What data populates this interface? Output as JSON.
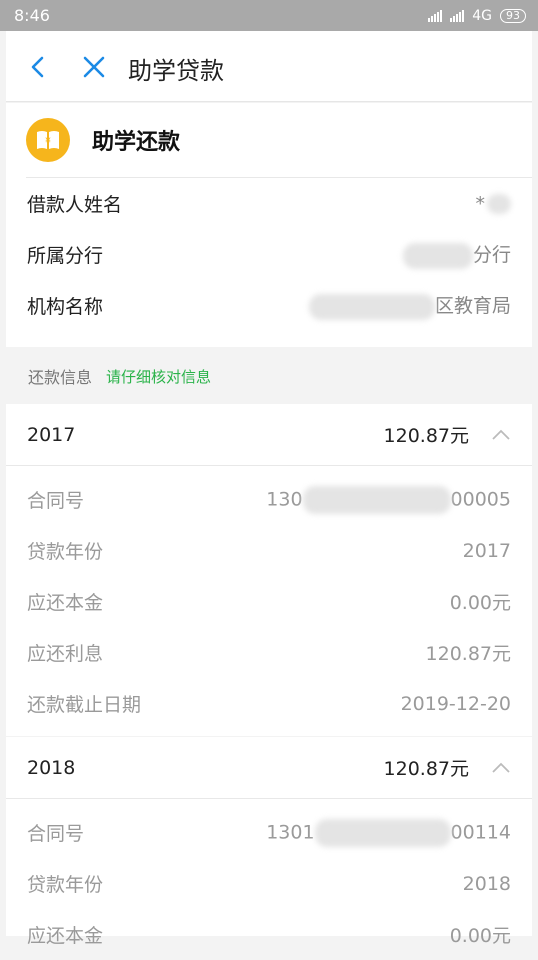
{
  "status": {
    "time": "8:46",
    "network": "4G",
    "battery": "93"
  },
  "header": {
    "title": "助学贷款"
  },
  "loan": {
    "title": "助学还款",
    "rows": [
      {
        "label": "借款人姓名",
        "value": "*"
      },
      {
        "label": "所属分行",
        "value": "分行"
      },
      {
        "label": "机构名称",
        "value": "区教育局"
      }
    ]
  },
  "repayment": {
    "label": "还款信息",
    "hint": "请仔细核对信息"
  },
  "years": [
    {
      "year": "2017",
      "amount": "120.87元",
      "contract_prefix": "130",
      "contract_suffix": "00005",
      "rows": [
        {
          "label": "合同号",
          "value": ""
        },
        {
          "label": "贷款年份",
          "value": "2017"
        },
        {
          "label": "应还本金",
          "value": "0.00元"
        },
        {
          "label": "应还利息",
          "value": "120.87元"
        },
        {
          "label": "还款截止日期",
          "value": "2019-12-20"
        }
      ]
    },
    {
      "year": "2018",
      "amount": "120.87元",
      "contract_prefix": "1301",
      "contract_suffix": "00114",
      "rows": [
        {
          "label": "合同号",
          "value": ""
        },
        {
          "label": "贷款年份",
          "value": "2018"
        },
        {
          "label": "应还本金",
          "value": "0.00元"
        }
      ]
    }
  ],
  "colors": {
    "accent_blue": "#1b8ae5",
    "icon_yellow": "#f6b51c",
    "hint_green": "#2ab34a"
  }
}
